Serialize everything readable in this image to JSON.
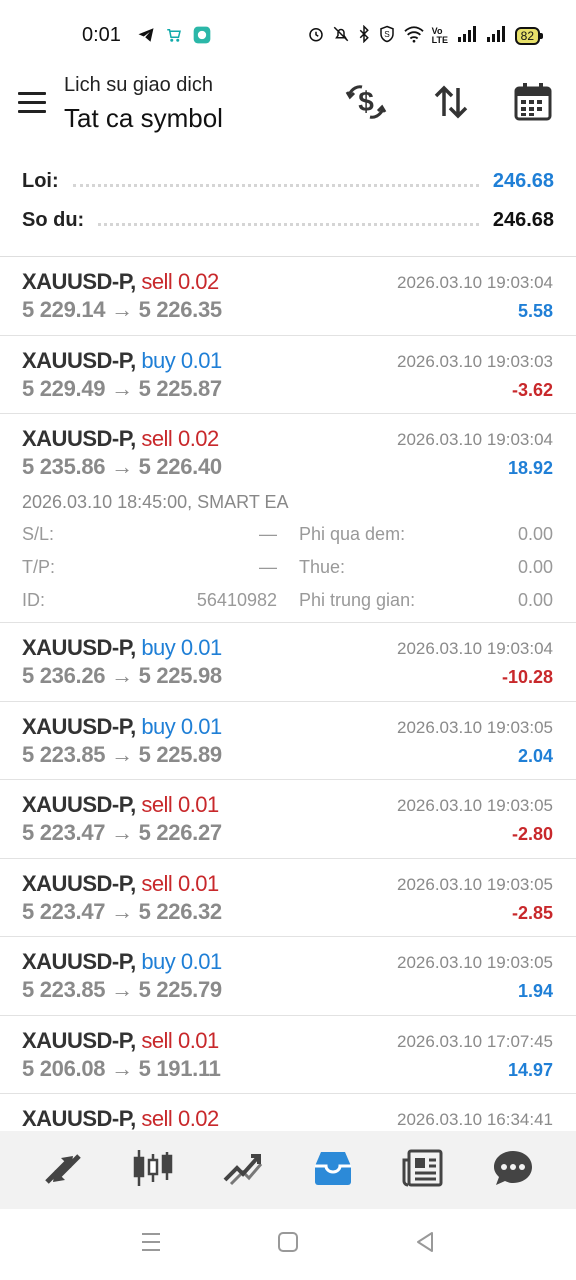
{
  "status_bar": {
    "time": "0:01",
    "battery": "82",
    "network_label": "Vo LTE"
  },
  "header": {
    "subtitle": "Lich su giao dich",
    "title": "Tat ca symbol"
  },
  "summary": {
    "profit_label": "Loi:",
    "profit_value": "246.68",
    "balance_label": "So du:",
    "balance_value": "246.68"
  },
  "deals": [
    {
      "symbol": "XAUUSD-P,",
      "side": "sell",
      "volume": "0.02",
      "time": "2026.03.10 19:03:04",
      "open_price": "5 229.14",
      "close_price": "5 226.35",
      "profit": "5.58"
    },
    {
      "symbol": "XAUUSD-P,",
      "side": "buy",
      "volume": "0.01",
      "time": "2026.03.10 19:03:03",
      "open_price": "5 229.49",
      "close_price": "5 225.87",
      "profit": "-3.62"
    },
    {
      "symbol": "XAUUSD-P,",
      "side": "sell",
      "volume": "0.02",
      "time": "2026.03.10 19:03:04",
      "open_price": "5 235.86",
      "close_price": "5 226.40",
      "profit": "18.92",
      "details": {
        "open_info": "2026.03.10 18:45:00, SMART EA",
        "sl_label": "S/L:",
        "sl_value": "—",
        "tp_label": "T/P:",
        "tp_value": "—",
        "id_label": "ID:",
        "id_value": "56410982",
        "swap_label": "Phi qua dem:",
        "swap_value": "0.00",
        "tax_label": "Thue:",
        "tax_value": "0.00",
        "commission_label": "Phi trung gian:",
        "commission_value": "0.00"
      }
    },
    {
      "symbol": "XAUUSD-P,",
      "side": "buy",
      "volume": "0.01",
      "time": "2026.03.10 19:03:04",
      "open_price": "5 236.26",
      "close_price": "5 225.98",
      "profit": "-10.28"
    },
    {
      "symbol": "XAUUSD-P,",
      "side": "buy",
      "volume": "0.01",
      "time": "2026.03.10 19:03:05",
      "open_price": "5 223.85",
      "close_price": "5 225.89",
      "profit": "2.04"
    },
    {
      "symbol": "XAUUSD-P,",
      "side": "sell",
      "volume": "0.01",
      "time": "2026.03.10 19:03:05",
      "open_price": "5 223.47",
      "close_price": "5 226.27",
      "profit": "-2.80"
    },
    {
      "symbol": "XAUUSD-P,",
      "side": "sell",
      "volume": "0.01",
      "time": "2026.03.10 19:03:05",
      "open_price": "5 223.47",
      "close_price": "5 226.32",
      "profit": "-2.85"
    },
    {
      "symbol": "XAUUSD-P,",
      "side": "buy",
      "volume": "0.01",
      "time": "2026.03.10 19:03:05",
      "open_price": "5 223.85",
      "close_price": "5 225.79",
      "profit": "1.94"
    },
    {
      "symbol": "XAUUSD-P,",
      "side": "sell",
      "volume": "0.01",
      "time": "2026.03.10 17:07:45",
      "open_price": "5 206.08",
      "close_price": "5 191.11",
      "profit": "14.97"
    },
    {
      "symbol": "XAUUSD-P,",
      "side": "sell",
      "volume": "0.02",
      "time": "2026.03.10 16:34:41",
      "open_price": "",
      "close_price": "",
      "profit": ""
    }
  ],
  "colors": {
    "sell": "#c8282b",
    "buy": "#1f7fd6",
    "active_tab": "#2c8ad8"
  },
  "bottom_nav": [
    "quotes-icon",
    "chart-icon",
    "trade-icon",
    "history-icon",
    "news-icon",
    "chat-icon"
  ],
  "active_tab": "history-icon"
}
